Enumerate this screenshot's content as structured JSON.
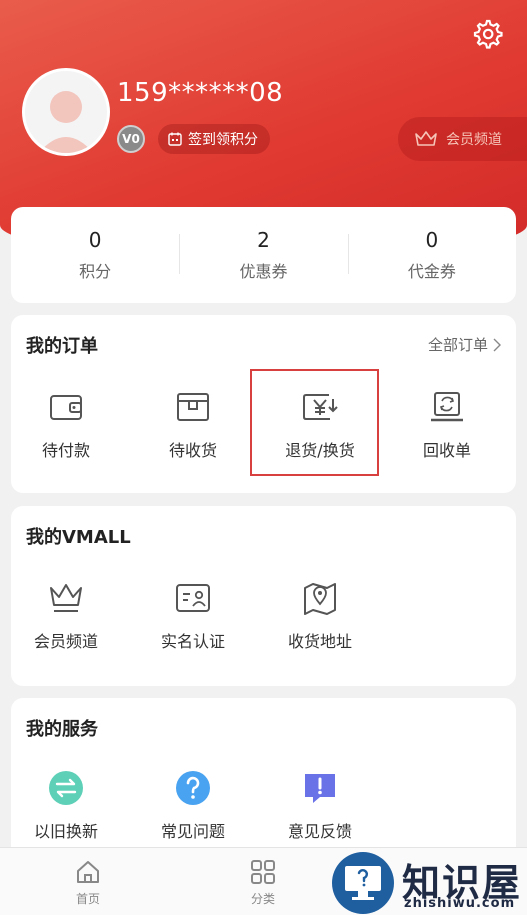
{
  "profile": {
    "phone": "159******08",
    "vip_level": "V0",
    "signin_label": "签到领积分",
    "member_channel_label": "会员频道"
  },
  "stats": [
    {
      "value": "0",
      "label": "积分"
    },
    {
      "value": "2",
      "label": "优惠券"
    },
    {
      "value": "0",
      "label": "代金券"
    }
  ],
  "orders": {
    "title": "我的订单",
    "all_label": "全部订单",
    "items": [
      {
        "label": "待付款",
        "icon": "wallet-icon"
      },
      {
        "label": "待收货",
        "icon": "package-icon"
      },
      {
        "label": "退货/换货",
        "icon": "yen-return-icon"
      },
      {
        "label": "回收单",
        "icon": "recycle-device-icon"
      }
    ]
  },
  "vmall": {
    "title": "我的VMALL",
    "items": [
      {
        "label": "会员频道",
        "icon": "crown-icon"
      },
      {
        "label": "实名认证",
        "icon": "id-card-icon"
      },
      {
        "label": "收货地址",
        "icon": "map-pin-icon"
      }
    ]
  },
  "services": {
    "title": "我的服务",
    "items": [
      {
        "label": "以旧换新",
        "icon": "exchange-icon"
      },
      {
        "label": "常见问题",
        "icon": "question-icon"
      },
      {
        "label": "意见反馈",
        "icon": "feedback-icon"
      }
    ]
  },
  "nav": [
    {
      "label": "首页",
      "icon": "home-icon"
    },
    {
      "label": "分类",
      "icon": "category-icon"
    }
  ],
  "watermark": {
    "text": "知识屋",
    "sub": "zhishiwu.com"
  },
  "colors": {
    "brand": "#e03a32",
    "highlight": "#d84040"
  }
}
